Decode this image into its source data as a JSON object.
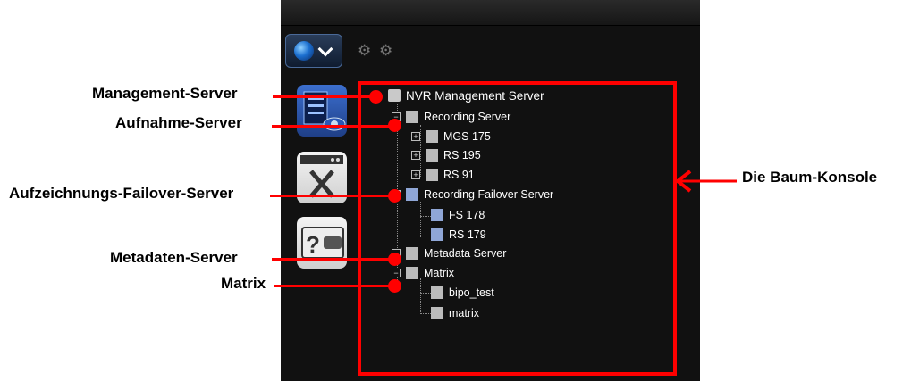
{
  "tree": {
    "management": "NVR Management Server",
    "recording": "Recording Server",
    "recording_children": [
      "MGS 175",
      "RS 195",
      "RS 91"
    ],
    "failover": "Recording Failover Server",
    "failover_children": [
      "FS 178",
      "RS 179"
    ],
    "metadata": "Metadata Server",
    "matrix": "Matrix",
    "matrix_children": [
      "bipo_test",
      "matrix"
    ]
  },
  "callouts": {
    "management": "Management-Server",
    "recording": "Aufnahme-Server",
    "failover": "Aufzeichnungs-Failover-Server",
    "metadata": "Metadaten-Server",
    "matrix": "Matrix",
    "console": "Die Baum-Konsole"
  },
  "icons": {
    "globe": "globe-icon",
    "dropdown": "chevron-down-icon",
    "tool_a": "settings-add-icon",
    "tool_b": "settings-refresh-icon",
    "side_1": "server-list-icon",
    "side_2": "tools-window-icon",
    "side_3": "help-wallet-icon"
  },
  "colors": {
    "annotation": "#ff0000",
    "panel": "#111111",
    "tree_text": "#ffffff"
  }
}
